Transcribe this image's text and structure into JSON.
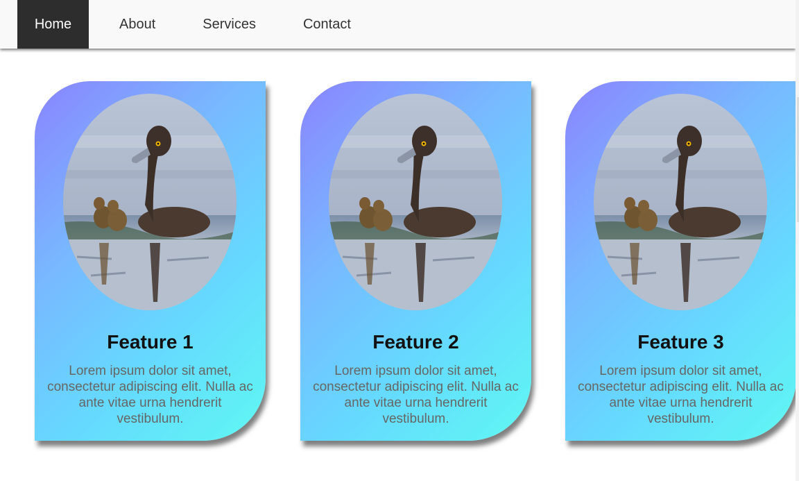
{
  "nav": {
    "items": [
      {
        "label": "Home",
        "active": true
      },
      {
        "label": "About",
        "active": false
      },
      {
        "label": "Services",
        "active": false
      },
      {
        "label": "Contact",
        "active": false
      }
    ]
  },
  "cards": [
    {
      "title": "Feature 1",
      "text": "Lorem ipsum dolor sit amet, consectetur adipiscing elit. Nulla ac ante vitae urna hendrerit vestibulum.",
      "image": "duck-with-ducklings"
    },
    {
      "title": "Feature 2",
      "text": "Lorem ipsum dolor sit amet, consectetur adipiscing elit. Nulla ac ante vitae urna hendrerit vestibulum.",
      "image": "duck-with-ducklings"
    },
    {
      "title": "Feature 3",
      "text": "Lorem ipsum dolor sit amet, consectetur adipiscing elit. Nulla ac ante vitae urna hendrerit vestibulum.",
      "image": "duck-with-ducklings"
    }
  ],
  "colors": {
    "nav_active_bg": "#2d2d2d",
    "nav_bg": "#f9f9f9",
    "card_gradient_start": "#8a84ff",
    "card_gradient_end": "#5ef8f2",
    "title_color": "#111111",
    "text_color": "#666666"
  }
}
